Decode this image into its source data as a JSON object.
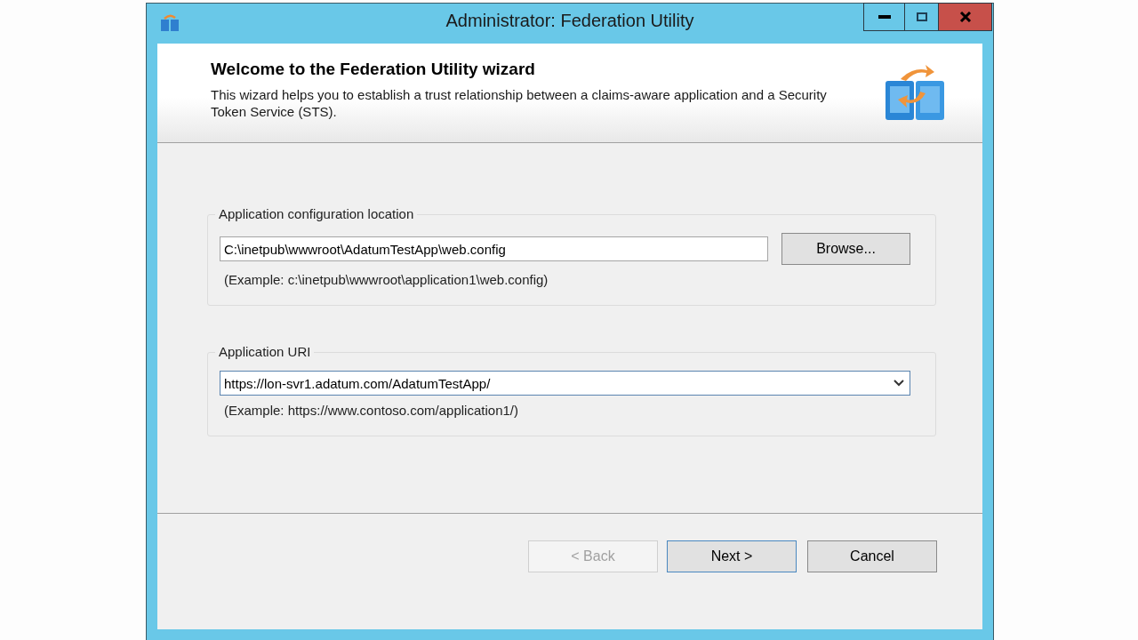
{
  "window": {
    "title": "Administrator: Federation Utility"
  },
  "header": {
    "title": "Welcome to the Federation Utility wizard",
    "description": "This wizard helps you to establish a trust relationship between a claims-aware application and a Security Token Service (STS)."
  },
  "groups": [
    {
      "label": "Application configuration location",
      "field": {
        "kind": "text",
        "value": "C:\\inetpub\\wwwroot\\AdatumTestApp\\web.config",
        "focused": false
      },
      "button": "Browse...",
      "example": "(Example: c:\\inetpub\\wwwroot\\application1\\web.config)"
    },
    {
      "label": "Application URI",
      "field": {
        "kind": "combo",
        "value": "https://lon-svr1.adatum.com/AdatumTestApp/",
        "focused": true
      },
      "example": "(Example: https://www.contoso.com/application1/)"
    }
  ],
  "buttons": [
    {
      "label": "< Back",
      "disabled": true,
      "default": false
    },
    {
      "label": "Next >",
      "disabled": false,
      "default": true
    },
    {
      "label": "Cancel",
      "disabled": false,
      "default": false
    }
  ]
}
